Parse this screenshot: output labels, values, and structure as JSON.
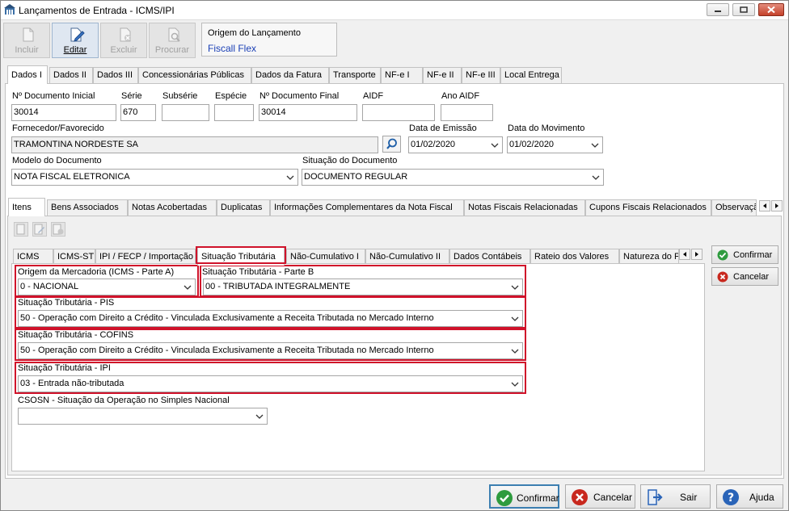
{
  "window": {
    "title": "Lançamentos de Entrada - ICMS/IPI"
  },
  "toolbar": {
    "incluir": "Incluir",
    "editar": "Editar",
    "excluir": "Excluir",
    "procurar": "Procurar"
  },
  "origem": {
    "label": "Origem do Lançamento",
    "value": "Fiscall Flex"
  },
  "top_tabs": [
    "Dados I",
    "Dados II",
    "Dados III",
    "Concessionárias Públicas",
    "Dados da Fatura",
    "Transporte",
    "NF-e I",
    "NF-e II",
    "NF-e III",
    "Local Entrega"
  ],
  "form": {
    "num_doc_inicial": {
      "label": "Nº Documento Inicial",
      "value": "30014"
    },
    "serie": {
      "label": "Série",
      "value": "670"
    },
    "subserie": {
      "label": "Subsérie",
      "value": ""
    },
    "especie": {
      "label": "Espécie",
      "value": ""
    },
    "num_doc_final": {
      "label": "Nº Documento Final",
      "value": "30014"
    },
    "aidf": {
      "label": "AIDF",
      "value": ""
    },
    "ano_aidf": {
      "label": "Ano AIDF",
      "value": ""
    },
    "fornecedor": {
      "label": "Fornecedor/Favorecido",
      "value": "TRAMONTINA NORDESTE SA"
    },
    "data_emissao": {
      "label": "Data de Emissão",
      "value": "01/02/2020"
    },
    "data_movimento": {
      "label": "Data do Movimento",
      "value": "01/02/2020"
    },
    "modelo": {
      "label": "Modelo do Documento",
      "value": "NOTA FISCAL ELETRONICA"
    },
    "situacao": {
      "label": "Situação do Documento",
      "value": "DOCUMENTO REGULAR"
    }
  },
  "mid_tabs": [
    "Itens",
    "Bens Associados",
    "Notas Acobertadas",
    "Duplicatas",
    "Informações Complementares da Nota Fiscal",
    "Notas Fiscais Relacionadas",
    "Cupons Fiscais Relacionados",
    "Observaçã"
  ],
  "inner_tabs": [
    "ICMS",
    "ICMS-ST",
    "IPI / FECP / Importação",
    "Situação Tributária",
    "Não-Cumulativo I",
    "Não-Cumulativo II",
    "Dados Contábeis",
    "Rateio dos Valores",
    "Natureza do F"
  ],
  "trib": {
    "origem": {
      "label": "Origem da Mercadoria (ICMS - Parte A)",
      "value": "0 - NACIONAL"
    },
    "parte_b": {
      "label": "Situação Tributária - Parte B",
      "value": "00 - TRIBUTADA INTEGRALMENTE"
    },
    "pis": {
      "label": "Situação Tributária - PIS",
      "value": "50 - Operação com Direito a Crédito - Vinculada Exclusivamente a Receita Tributada no Mercado Interno"
    },
    "cofins": {
      "label": "Situação Tributária - COFINS",
      "value": "50 - Operação com Direito a Crédito - Vinculada Exclusivamente a Receita Tributada no Mercado Interno"
    },
    "ipi": {
      "label": "Situação Tributária - IPI",
      "value": "03 - Entrada não-tributada"
    },
    "csosn": {
      "label": "CSOSN - Situação da Operação no Simples Nacional",
      "value": ""
    }
  },
  "side_buttons": {
    "confirmar": "Confirmar",
    "cancelar": "Cancelar"
  },
  "bottom_buttons": {
    "confirmar": "Confirmar",
    "cancelar": "Cancelar",
    "sair": "Sair",
    "ajuda": "Ajuda"
  },
  "colors": {
    "highlight": "#d0122a",
    "link_blue": "#1a3fb5",
    "confirm_green": "#2e9b3e",
    "cancel_red": "#c8281e",
    "help_blue": "#2a64b8"
  }
}
